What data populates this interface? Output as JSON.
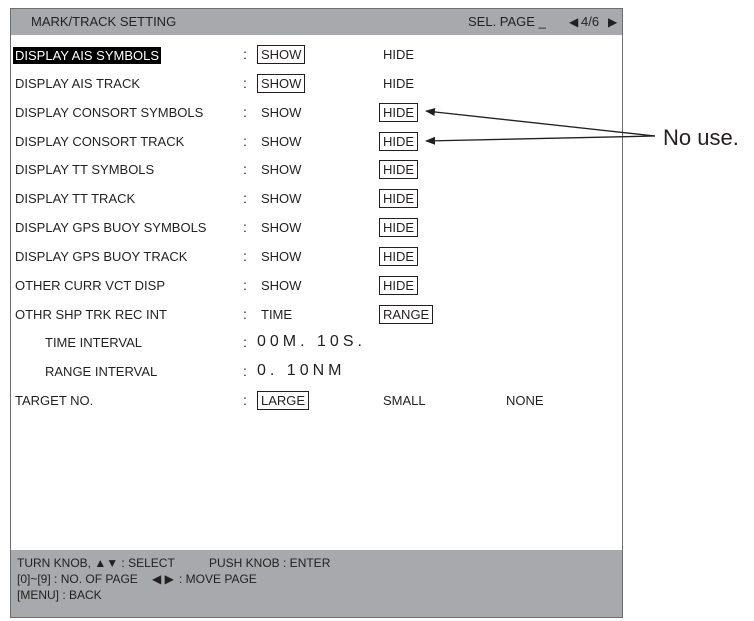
{
  "header": {
    "title": "MARK/TRACK SETTING",
    "sel_page": "SEL. PAGE _",
    "page_left_icon": "◀",
    "page_num": "4/6",
    "page_right_icon": "▶"
  },
  "rows": [
    {
      "label": "DISPLAY AIS SYMBOLS",
      "colon": ":",
      "opt1": "SHOW",
      "opt2": "HIDE"
    },
    {
      "label": "DISPLAY AIS TRACK",
      "colon": ":",
      "opt1": "SHOW",
      "opt2": "HIDE"
    },
    {
      "label": "DISPLAY CONSORT SYMBOLS",
      "colon": ":",
      "opt1": "SHOW",
      "opt2": "HIDE"
    },
    {
      "label": "DISPLAY CONSORT TRACK",
      "colon": ":",
      "opt1": "SHOW",
      "opt2": "HIDE"
    },
    {
      "label": "DISPLAY TT SYMBOLS",
      "colon": ":",
      "opt1": "SHOW",
      "opt2": "HIDE"
    },
    {
      "label": "DISPLAY TT TRACK",
      "colon": ":",
      "opt1": "SHOW",
      "opt2": "HIDE"
    },
    {
      "label": "DISPLAY GPS BUOY SYMBOLS",
      "colon": ":",
      "opt1": "SHOW",
      "opt2": "HIDE"
    },
    {
      "label": "DISPLAY GPS BUOY TRACK",
      "colon": ":",
      "opt1": "SHOW",
      "opt2": "HIDE"
    },
    {
      "label": "OTHER CURR VCT DISP",
      "colon": ":",
      "opt1": "SHOW",
      "opt2": "HIDE"
    },
    {
      "label": "OTHR SHP TRK REC INT",
      "colon": ":",
      "opt1": "TIME",
      "opt2": "RANGE"
    },
    {
      "label": "TIME INTERVAL",
      "colon": ":",
      "value": "00M. 10S."
    },
    {
      "label": "RANGE INTERVAL",
      "colon": ":",
      "value": "0. 10NM"
    },
    {
      "label": "TARGET NO.",
      "colon": ":",
      "opt1": "LARGE",
      "opt2": "SMALL",
      "opt3": "NONE"
    }
  ],
  "footer": {
    "line1_a": "TURN KNOB, ▲▼ : SELECT",
    "line1_b": "PUSH KNOB : ENTER",
    "line2_a": "[0]~[9] : NO. OF PAGE",
    "line2_icons": "◀ ▶",
    "line2_b": ": MOVE PAGE",
    "line3": "[MENU] : BACK"
  },
  "annotation": {
    "text": "No use."
  }
}
